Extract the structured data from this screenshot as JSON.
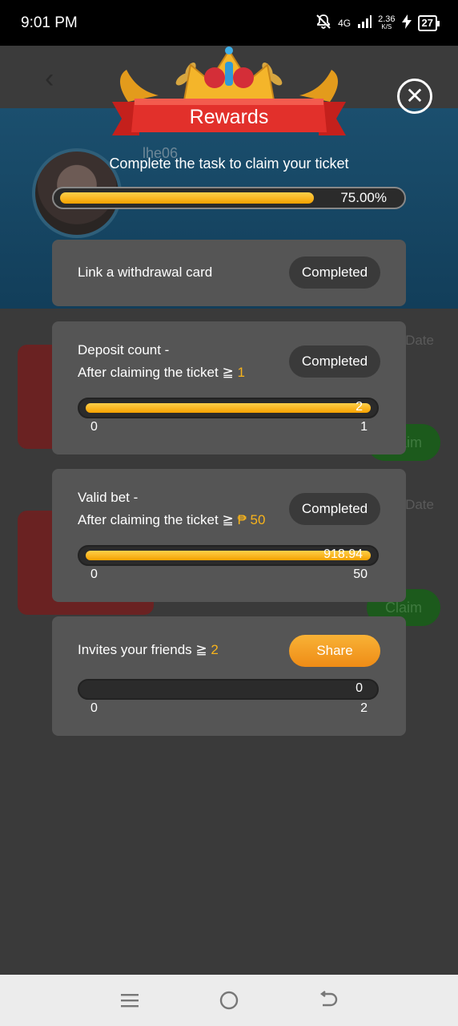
{
  "status_bar": {
    "time": "9:01 PM",
    "network": "4G",
    "speed": "2.36",
    "speed_unit": "K/S",
    "battery": "27"
  },
  "background": {
    "username": "lhe06",
    "date_label": "Date",
    "claim_label": "Claim"
  },
  "modal": {
    "title": "Rewards",
    "subtitle": "Complete the task to claim your ticket",
    "progress_percent": 75.0,
    "progress_text": "75.00%"
  },
  "tasks": [
    {
      "label": "Link a withdrawal card",
      "status": "Completed"
    },
    {
      "label_line1": "Deposit count -",
      "label_line2": "After claiming the ticket ≧ ",
      "threshold": "1",
      "status": "Completed",
      "current": "2",
      "min": "0",
      "max": "1",
      "fill_fraction": 1.0
    },
    {
      "label_line1": "Valid bet -",
      "label_line2": "After claiming the ticket ≧ ",
      "threshold": "₱ 50",
      "status": "Completed",
      "current": "918.94",
      "min": "0",
      "max": "50",
      "fill_fraction": 1.0
    },
    {
      "label": "Invites your friends ≧ ",
      "threshold": "2",
      "status": "Share",
      "current": "0",
      "min": "0",
      "max": "2",
      "fill_fraction": 0.0
    }
  ],
  "colors": {
    "accent_gold": "#f7b31c",
    "progress_fill": "#f5a100",
    "share_button": "#ef8c16",
    "ribbon_red": "#e2302b"
  }
}
